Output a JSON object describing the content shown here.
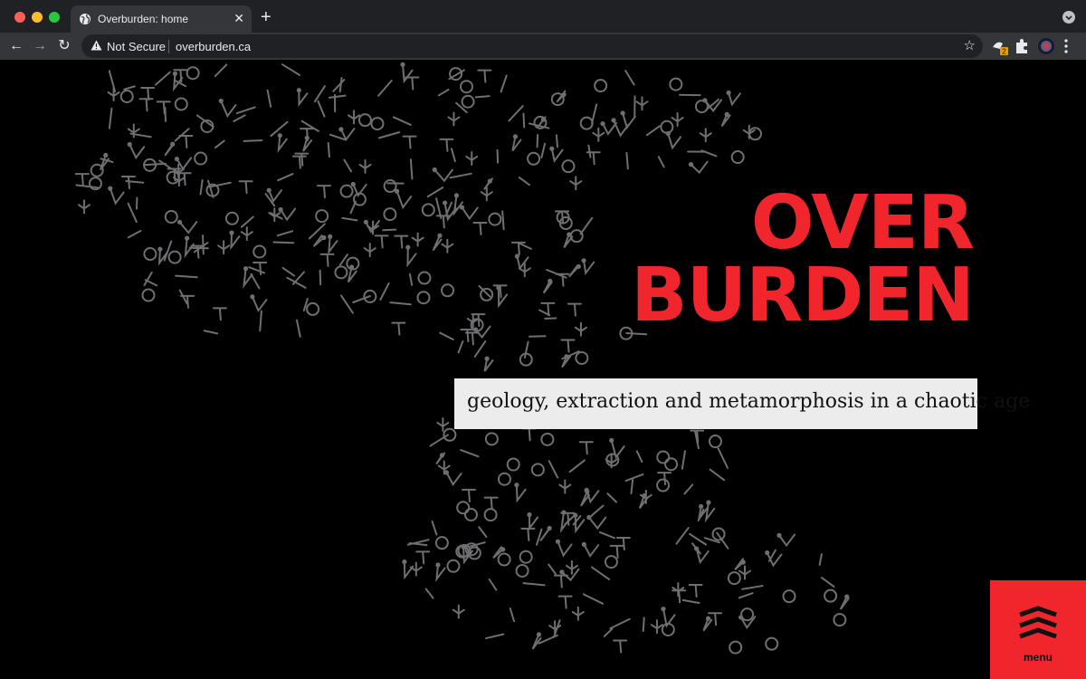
{
  "browser": {
    "tab_title": "Overburden: home",
    "security_label": "Not Secure",
    "url": "overburden.ca",
    "extension_badge": "2"
  },
  "page": {
    "title_line1": "OVER",
    "title_line2": "BURDEN",
    "tagline": "geology, extraction and metamorphosis in a chaotic age",
    "menu_label": "menu"
  },
  "colors": {
    "accent": "#f0262c",
    "background": "#000000",
    "glyph": "#6f6f72",
    "tagline_bg": "#ececec"
  },
  "icons": [
    "globe-icon",
    "close-icon",
    "plus-icon",
    "back-icon",
    "forward-icon",
    "reload-icon",
    "warning-icon",
    "star-icon",
    "extension-icon",
    "puzzle-icon",
    "profile-icon",
    "kebab-icon",
    "wave-menu-icon"
  ]
}
